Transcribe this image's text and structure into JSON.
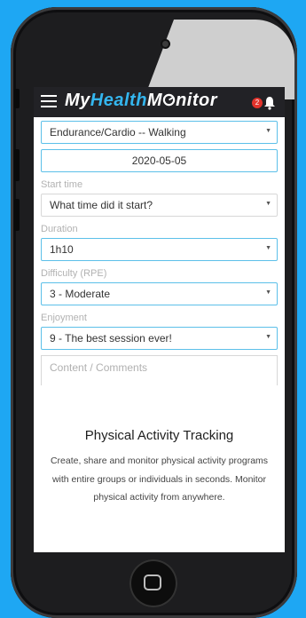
{
  "app": {
    "logo_my": "My",
    "logo_health": "Health",
    "logo_monitor": "M",
    "logo_after_o": "nitor",
    "notification_count": "2"
  },
  "form": {
    "activity_value": "Endurance/Cardio -- Walking",
    "date_value": "2020-05-05",
    "start_time_label": "Start time",
    "start_time_value": "What time did it start?",
    "duration_label": "Duration",
    "duration_value": "1h10",
    "difficulty_label": "Difficulty (RPE)",
    "difficulty_value": "3 - Moderate",
    "enjoyment_label": "Enjoyment",
    "enjoyment_value": "9 - The best session ever!",
    "comments_placeholder": "Content / Comments"
  },
  "promo": {
    "title": "Physical Activity Tracking",
    "text": "Create, share and monitor physical activity programs with entire groups or individuals in seconds. Monitor physical activity from anywhere."
  },
  "icons": {
    "menu": "hamburger-icon",
    "bell": "bell-icon",
    "caret": "caret-down-icon",
    "home": "home-button-icon"
  },
  "colors": {
    "background": "#1ea7f3",
    "appbar": "#222226",
    "accent": "#34b6ef",
    "badge": "#e2332c"
  }
}
